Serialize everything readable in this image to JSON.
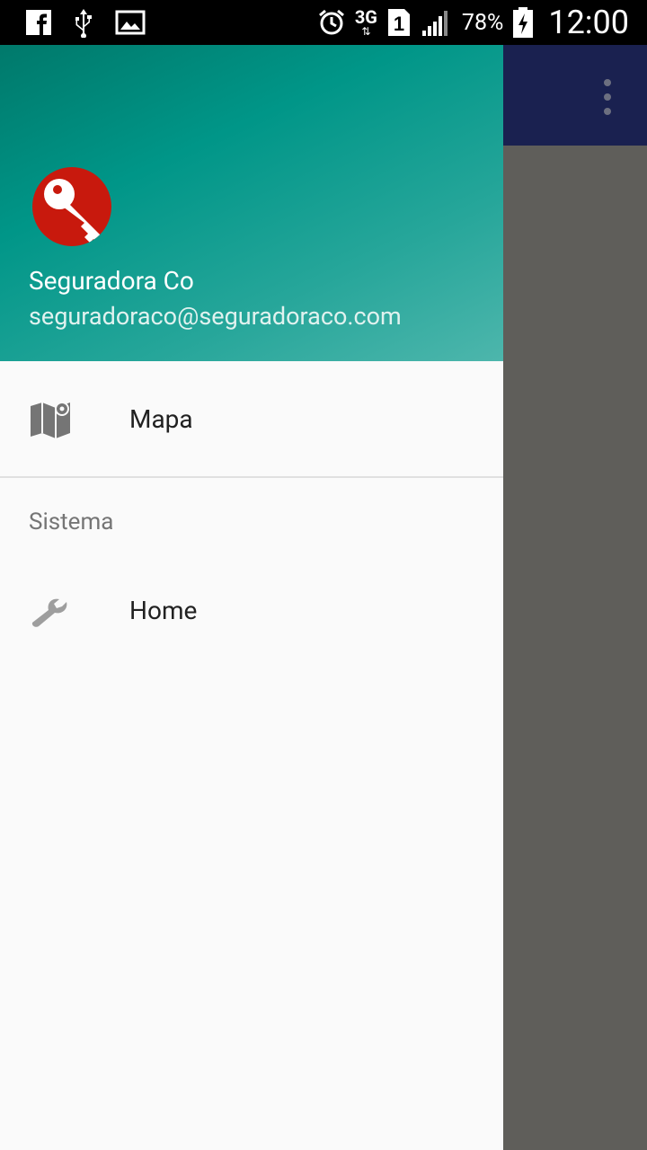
{
  "status_bar": {
    "battery_percent": "78%",
    "clock": "12:00",
    "network_type": "3G",
    "sim_slot": "1",
    "icons": [
      "facebook-icon",
      "usb-icon",
      "image-icon",
      "alarm-icon",
      "network-3g-icon",
      "sim-1-icon",
      "signal-icon",
      "battery-charging-icon"
    ]
  },
  "drawer": {
    "header": {
      "name": "Seguradora Co",
      "email": "seguradoraco@seguradoraco.com",
      "avatar_icon": "key-icon",
      "avatar_color": "#c8190d"
    },
    "items": [
      {
        "label": "Mapa",
        "icon": "map-icon"
      }
    ],
    "sections": [
      {
        "title": "Sistema",
        "items": [
          {
            "label": "Home",
            "icon": "wrench-icon"
          }
        ]
      }
    ]
  },
  "app": {
    "toolbar_color": "#1a2150",
    "overflow_icon": "more-vert-icon"
  }
}
